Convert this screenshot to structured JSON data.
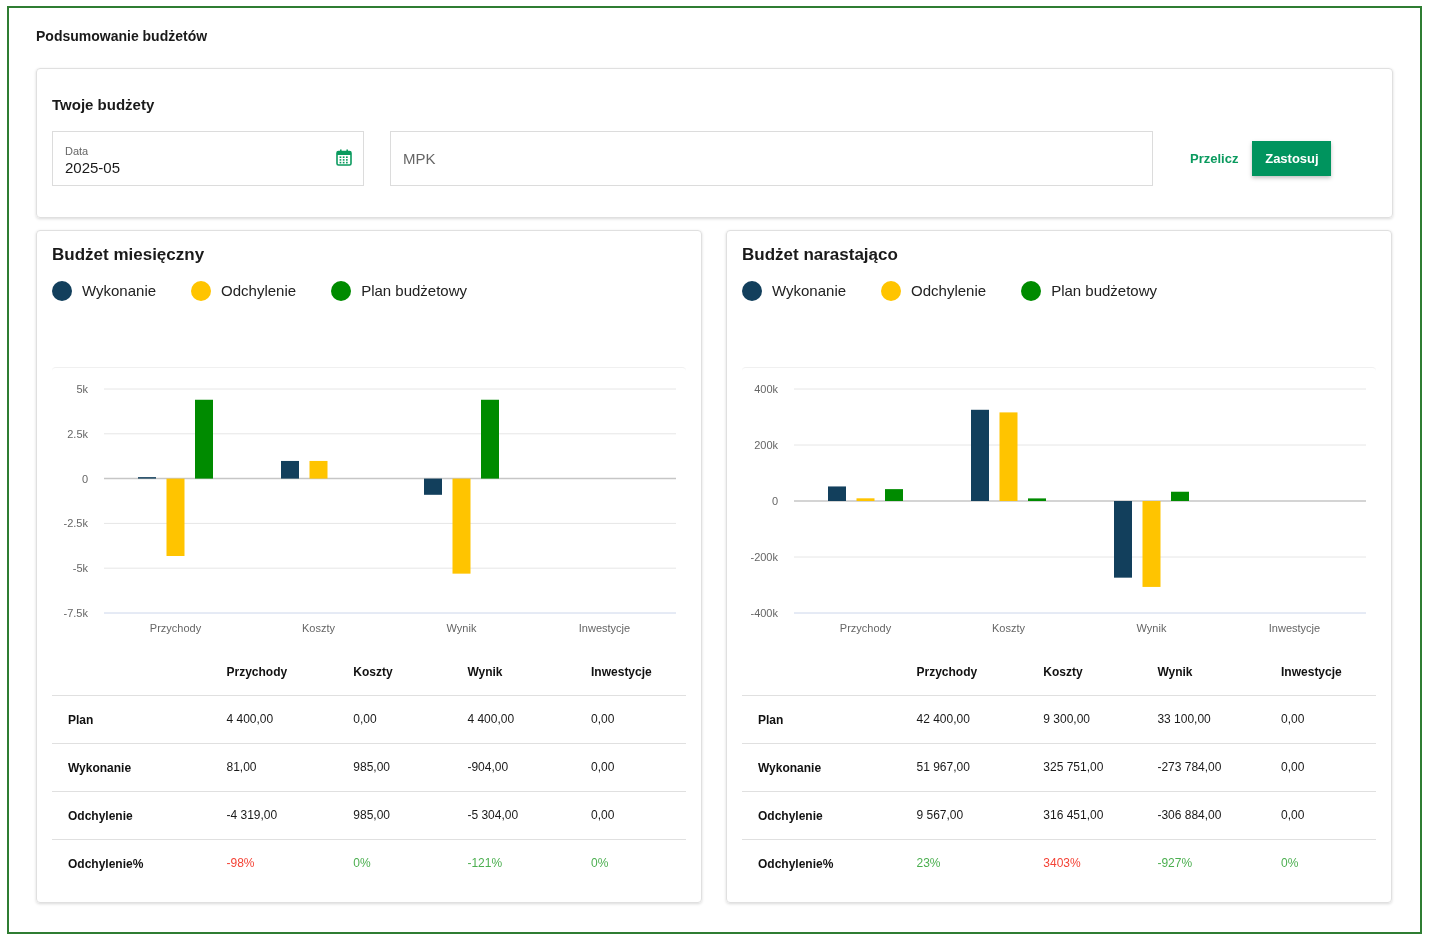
{
  "page_title": "Podsumowanie budżetów",
  "filters": {
    "title": "Twoje budżety",
    "date_field": {
      "label": "Data",
      "value": "2025-05"
    },
    "mpk_field": {
      "placeholder": "MPK"
    },
    "recalculate_link": "Przelicz",
    "apply_button": "Zastosuj"
  },
  "panels": [
    {
      "title": "Budżet miesięczny",
      "chart_data": {
        "type": "bar",
        "legend": "top",
        "grid": true,
        "categories": [
          "Przychody",
          "Koszty",
          "Wynik",
          "Inwestycje"
        ],
        "series": [
          {
            "name": "Wykonanie",
            "color": "#123f5c",
            "values": [
              81,
              985,
              -904,
              0
            ]
          },
          {
            "name": "Odchylenie",
            "color": "#ffc400",
            "values": [
              -4319,
              985,
              -5304,
              0
            ]
          },
          {
            "name": "Plan budżetowy",
            "color": "#008b00",
            "values": [
              4400,
              0,
              4400,
              0
            ]
          }
        ],
        "ylim": [
          -7500,
          5000
        ],
        "yticks": [
          {
            "value": 5000,
            "label": "5k"
          },
          {
            "value": 2500,
            "label": "2.5k"
          },
          {
            "value": 0,
            "label": "0"
          },
          {
            "value": -2500,
            "label": "-2.5k"
          },
          {
            "value": -5000,
            "label": "-5k"
          },
          {
            "value": -7500,
            "label": "-7.5k"
          }
        ]
      },
      "table": {
        "columns": [
          "Przychody",
          "Koszty",
          "Wynik",
          "Inwestycje"
        ],
        "rows": [
          {
            "kind": "amount",
            "label": "Plan",
            "cells": [
              "4 400,00",
              "0,00",
              "4 400,00",
              "0,00"
            ]
          },
          {
            "kind": "amount",
            "label": "Wykonanie",
            "cells": [
              "81,00",
              "985,00",
              "-904,00",
              "0,00"
            ]
          },
          {
            "kind": "amount",
            "label": "Odchylenie",
            "cells": [
              "-4 319,00",
              "985,00",
              "-5 304,00",
              "0,00"
            ]
          },
          {
            "kind": "percent",
            "label": "Odchylenie%",
            "cells": [
              {
                "text": "-98%",
                "color": "#f44336"
              },
              {
                "text": "0%",
                "color": "#4caf50"
              },
              {
                "text": "-121%",
                "color": "#4caf50"
              },
              {
                "text": "0%",
                "color": "#4caf50"
              }
            ]
          }
        ]
      }
    },
    {
      "title": "Budżet narastająco",
      "chart_data": {
        "type": "bar",
        "legend": "top",
        "grid": true,
        "categories": [
          "Przychody",
          "Koszty",
          "Wynik",
          "Inwestycje"
        ],
        "series": [
          {
            "name": "Wykonanie",
            "color": "#123f5c",
            "values": [
              51967,
              325751,
              -273784,
              0
            ]
          },
          {
            "name": "Odchylenie",
            "color": "#ffc400",
            "values": [
              9567,
              316451,
              -306884,
              0
            ]
          },
          {
            "name": "Plan budżetowy",
            "color": "#008b00",
            "values": [
              42400,
              9300,
              33100,
              0
            ]
          }
        ],
        "ylim": [
          -400000,
          400000
        ],
        "yticks": [
          {
            "value": 400000,
            "label": "400k"
          },
          {
            "value": 200000,
            "label": "200k"
          },
          {
            "value": 0,
            "label": "0"
          },
          {
            "value": -200000,
            "label": "-200k"
          },
          {
            "value": -400000,
            "label": "-400k"
          }
        ]
      },
      "table": {
        "columns": [
          "Przychody",
          "Koszty",
          "Wynik",
          "Inwestycje"
        ],
        "rows": [
          {
            "kind": "amount",
            "label": "Plan",
            "cells": [
              "42 400,00",
              "9 300,00",
              "33 100,00",
              "0,00"
            ]
          },
          {
            "kind": "amount",
            "label": "Wykonanie",
            "cells": [
              "51 967,00",
              "325 751,00",
              "-273 784,00",
              "0,00"
            ]
          },
          {
            "kind": "amount",
            "label": "Odchylenie",
            "cells": [
              "9 567,00",
              "316 451,00",
              "-306 884,00",
              "0,00"
            ]
          },
          {
            "kind": "percent",
            "label": "Odchylenie%",
            "cells": [
              {
                "text": "23%",
                "color": "#4caf50"
              },
              {
                "text": "3403%",
                "color": "#f44336"
              },
              {
                "text": "-927%",
                "color": "#4caf50"
              },
              {
                "text": "0%",
                "color": "#4caf50"
              }
            ]
          }
        ]
      }
    }
  ]
}
